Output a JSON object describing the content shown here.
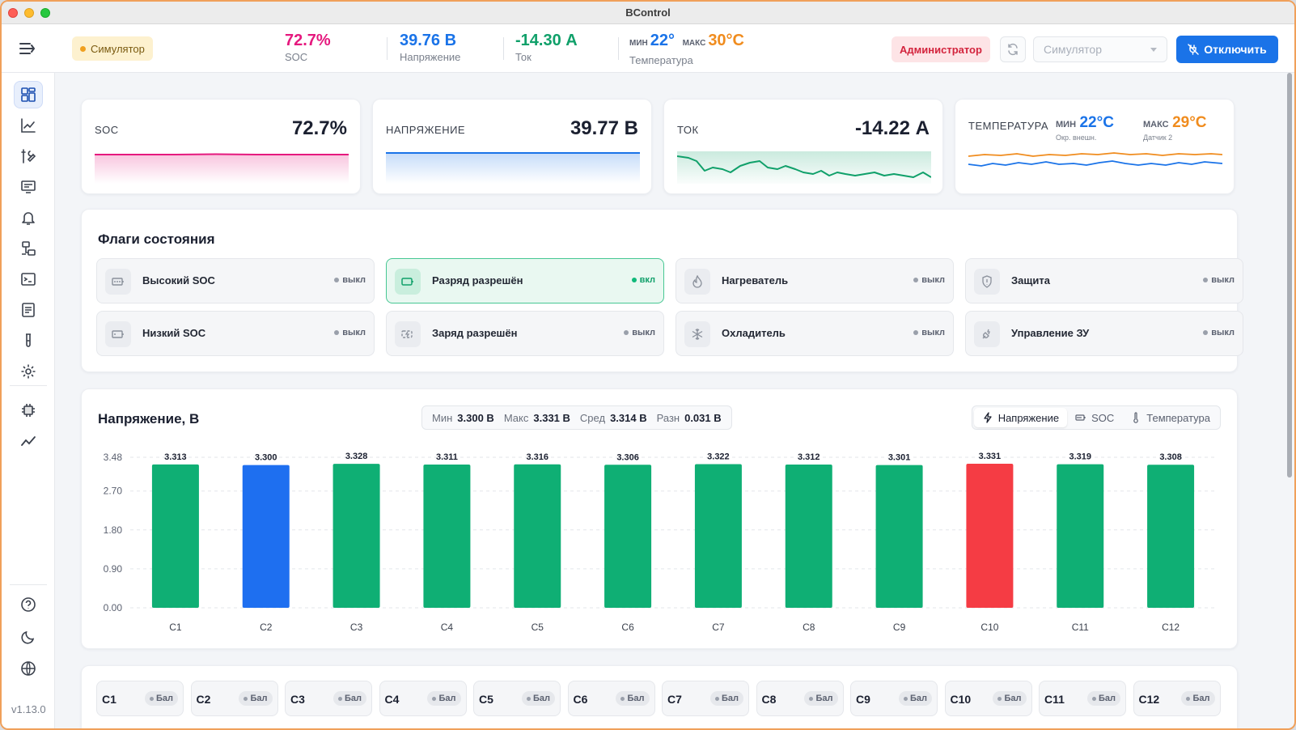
{
  "window": {
    "title": "BControl"
  },
  "header": {
    "mode_badge": "Симулятор",
    "soc": {
      "value": "72.7%",
      "label": "SOC",
      "color": "#e5197e"
    },
    "voltage": {
      "value": "39.76 В",
      "label": "Напряжение",
      "color": "#1a73e8"
    },
    "current": {
      "value": "-14.30 А",
      "label": "Ток",
      "color": "#10a06a"
    },
    "temperature": {
      "min_label": "МИН",
      "min_value": "22°",
      "max_label": "МАКС",
      "max_value": "30°C",
      "label": "Температура",
      "min_color": "#1a73e8",
      "max_color": "#f08c1e"
    },
    "role": "Администратор",
    "device_select": {
      "placeholder": "Симулятор"
    },
    "disconnect_label": "Отключить"
  },
  "sidebar": {
    "items": [
      {
        "icon": "dashboard-icon",
        "active": true
      },
      {
        "icon": "chart-line-icon"
      },
      {
        "icon": "tools-icon"
      },
      {
        "icon": "monitor-icon"
      },
      {
        "icon": "bell-icon"
      },
      {
        "icon": "network-icon"
      },
      {
        "icon": "terminal-icon"
      },
      {
        "icon": "document-icon"
      },
      {
        "icon": "test-tube-icon"
      },
      {
        "icon": "gear-icon"
      },
      {
        "icon": "chip-icon"
      },
      {
        "icon": "trend-icon"
      }
    ],
    "bottom": [
      {
        "icon": "help-icon"
      },
      {
        "icon": "moon-icon"
      },
      {
        "icon": "globe-icon"
      }
    ],
    "version": "v1.13.0"
  },
  "kpis": {
    "soc": {
      "label": "SOC",
      "value": "72.7%",
      "color": "#e5197e"
    },
    "voltage": {
      "label": "НАПРЯЖЕНИЕ",
      "value": "39.77 В",
      "color": "#1a73e8"
    },
    "current": {
      "label": "ТОК",
      "value": "-14.22 А",
      "color": "#10a06a"
    },
    "temperature": {
      "label": "ТЕМПЕРАТУРА",
      "min_label": "МИН",
      "min_value": "22°C",
      "min_sub": "Окр. внешн.",
      "max_label": "МАКС",
      "max_value": "29°C",
      "max_sub": "Датчик 2",
      "min_color": "#1a73e8",
      "max_color": "#f08c1e"
    }
  },
  "flags": {
    "title": "Флаги состояния",
    "items": [
      {
        "name": "Высокий SOC",
        "state": "выкл",
        "on": false,
        "icon": "battery-full-icon"
      },
      {
        "name": "Разряд разрешён",
        "state": "вкл",
        "on": true,
        "icon": "battery-discharge-icon"
      },
      {
        "name": "Нагреватель",
        "state": "выкл",
        "on": false,
        "icon": "flame-icon"
      },
      {
        "name": "Защита",
        "state": "выкл",
        "on": false,
        "icon": "shield-icon"
      },
      {
        "name": "Низкий SOC",
        "state": "выкл",
        "on": false,
        "icon": "battery-low-icon"
      },
      {
        "name": "Заряд разрешён",
        "state": "выкл",
        "on": false,
        "icon": "battery-charge-icon"
      },
      {
        "name": "Охладитель",
        "state": "выкл",
        "on": false,
        "icon": "snowflake-icon"
      },
      {
        "name": "Управление ЗУ",
        "state": "выкл",
        "on": false,
        "icon": "plug-icon"
      }
    ]
  },
  "voltage_panel": {
    "title": "Напряжение, В",
    "stats": {
      "min_label": "Мин",
      "min": "3.300 В",
      "max_label": "Макс",
      "max": "3.331 В",
      "avg_label": "Сред",
      "avg": "3.314 В",
      "diff_label": "Разн",
      "diff": "0.031 В"
    },
    "tabs": [
      {
        "label": "Напряжение",
        "icon": "lightning-icon",
        "active": true
      },
      {
        "label": "SOC",
        "icon": "battery-icon",
        "active": false
      },
      {
        "label": "Температура",
        "icon": "thermometer-icon",
        "active": false
      }
    ]
  },
  "chart_data": {
    "type": "bar",
    "categories": [
      "C1",
      "C2",
      "C3",
      "C4",
      "C5",
      "C6",
      "C7",
      "C8",
      "C9",
      "C10",
      "C11",
      "C12"
    ],
    "values": [
      3.313,
      3.3,
      3.328,
      3.311,
      3.316,
      3.306,
      3.322,
      3.312,
      3.301,
      3.331,
      3.319,
      3.308
    ],
    "value_labels": [
      "3.313",
      "3.300",
      "3.328",
      "3.311",
      "3.316",
      "3.306",
      "3.322",
      "3.312",
      "3.301",
      "3.331",
      "3.319",
      "3.308"
    ],
    "yticks": [
      "0.00",
      "0.90",
      "1.80",
      "2.70",
      "3.48"
    ],
    "ytick_values": [
      0,
      0.9,
      1.8,
      2.7,
      3.48
    ],
    "ylim": [
      0,
      3.48
    ],
    "bar_colors": [
      "#0faf74",
      "#1e6ff0",
      "#0faf74",
      "#0faf74",
      "#0faf74",
      "#0faf74",
      "#0faf74",
      "#0faf74",
      "#0faf74",
      "#f53c44",
      "#0faf74",
      "#0faf74"
    ],
    "grid": true,
    "xlabel": "",
    "ylabel": ""
  },
  "cells": {
    "items": [
      {
        "name": "C1",
        "badge": "Бал"
      },
      {
        "name": "C2",
        "badge": "Бал"
      },
      {
        "name": "C3",
        "badge": "Бал"
      },
      {
        "name": "C4",
        "badge": "Бал"
      },
      {
        "name": "C5",
        "badge": "Бал"
      },
      {
        "name": "C6",
        "badge": "Бал"
      },
      {
        "name": "C7",
        "badge": "Бал"
      },
      {
        "name": "C8",
        "badge": "Бал"
      },
      {
        "name": "C9",
        "badge": "Бал"
      },
      {
        "name": "C10",
        "badge": "Бал"
      },
      {
        "name": "C11",
        "badge": "Бал"
      },
      {
        "name": "C12",
        "badge": "Бал"
      }
    ]
  }
}
